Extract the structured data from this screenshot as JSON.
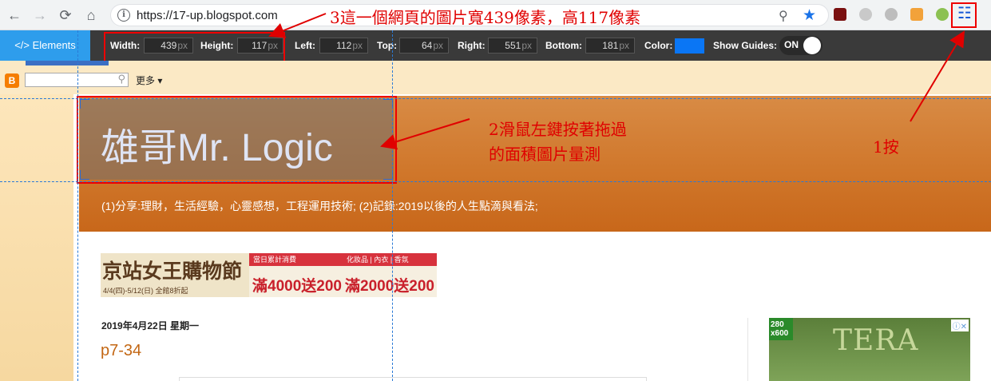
{
  "browser": {
    "url": "https://17-up.blogspot.com",
    "nav_back_icon": "arrow-left",
    "nav_forward_icon": "arrow-right",
    "reload_icon": "reload",
    "home_icon": "home",
    "info_icon_glyph": "i"
  },
  "measure_toolbar": {
    "elements_tab": "</> Elements",
    "width_label": "Width:",
    "width_value": "439",
    "height_label": "Height:",
    "height_value": "117",
    "left_label": "Left:",
    "left_value": "112",
    "top_label": "Top:",
    "top_value": "64",
    "right_label": "Right:",
    "right_value": "551",
    "bottom_label": "Bottom:",
    "bottom_value": "181",
    "unit": "px",
    "color_label": "Color:",
    "color_value": "#0a76f5",
    "guides_label": "Show Guides:",
    "guides_state": "ON"
  },
  "blogger_bar": {
    "more_label": "更多 ▾",
    "search_placeholder": ""
  },
  "blog": {
    "title": "雄哥Mr. Logic",
    "description": "(1)分享:理財，生活經驗，心靈感想，工程運用技術; (2)記錄:2019以後的人生點滴與看法;",
    "post_date": "2019年4月22日 星期一",
    "post_title": "p7-34"
  },
  "ad_banner": {
    "brand": "京站女王購物節",
    "dates": "4/4(四)-5/12(日) 全館8折起",
    "head1": "當日累計消費",
    "head2": "化妝品 | 內衣 | 香氛",
    "amount1": "滿4000送200",
    "amount2": "滿2000送200"
  },
  "side_ad": {
    "badge": "280 x600",
    "logo": "TERA",
    "close": "ⓘ✕"
  },
  "annotations": {
    "step1": "1按",
    "step2_line1": "2滑鼠左鍵按著拖過",
    "step2_line2": "的面積圖片量測",
    "step3": "3這一個網頁的圖片寬439像素，高117像素"
  },
  "colors": {
    "header_orange": "#d0772b",
    "annotation_red": "#e00000",
    "guide_blue": "#2a7ad6",
    "elements_tab_blue": "#2e9dec"
  }
}
